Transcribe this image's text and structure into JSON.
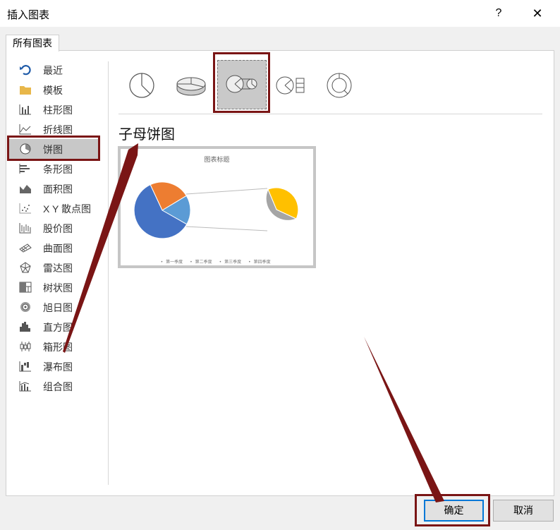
{
  "window": {
    "title": "插入图表",
    "help_label": "?",
    "close_label": "✕"
  },
  "tab": {
    "label": "所有图表"
  },
  "sidebar": {
    "items": [
      {
        "label": "最近",
        "icon": "recent-icon"
      },
      {
        "label": "模板",
        "icon": "folder-icon"
      },
      {
        "label": "柱形图",
        "icon": "column-chart-icon"
      },
      {
        "label": "折线图",
        "icon": "line-chart-icon"
      },
      {
        "label": "饼图",
        "icon": "pie-chart-icon",
        "selected": true
      },
      {
        "label": "条形图",
        "icon": "bar-chart-icon"
      },
      {
        "label": "面积图",
        "icon": "area-chart-icon"
      },
      {
        "label": "X Y 散点图",
        "icon": "scatter-chart-icon"
      },
      {
        "label": "股价图",
        "icon": "stock-chart-icon"
      },
      {
        "label": "曲面图",
        "icon": "surface-chart-icon"
      },
      {
        "label": "雷达图",
        "icon": "radar-chart-icon"
      },
      {
        "label": "树状图",
        "icon": "treemap-chart-icon"
      },
      {
        "label": "旭日图",
        "icon": "sunburst-chart-icon"
      },
      {
        "label": "直方图",
        "icon": "histogram-chart-icon"
      },
      {
        "label": "箱形图",
        "icon": "box-whisker-chart-icon"
      },
      {
        "label": "瀑布图",
        "icon": "waterfall-chart-icon"
      },
      {
        "label": "组合图",
        "icon": "combo-chart-icon"
      }
    ]
  },
  "subtypes": {
    "selected_title": "子母饼图",
    "icons": [
      "pie-icon",
      "3d-pie-icon",
      "pie-of-pie-icon",
      "bar-of-pie-icon",
      "doughnut-icon"
    ],
    "selected_index": 2
  },
  "preview": {
    "chart_title": "图表标题",
    "legend": [
      "第一季度",
      "第二季度",
      "第三季度",
      "第四季度"
    ],
    "colors": [
      "#4472c4",
      "#ed7d31",
      "#a5a5a5",
      "#ffc000",
      "#5b9bd5"
    ]
  },
  "buttons": {
    "ok": "确定",
    "cancel": "取消"
  },
  "annotation_color": "#7a1515"
}
